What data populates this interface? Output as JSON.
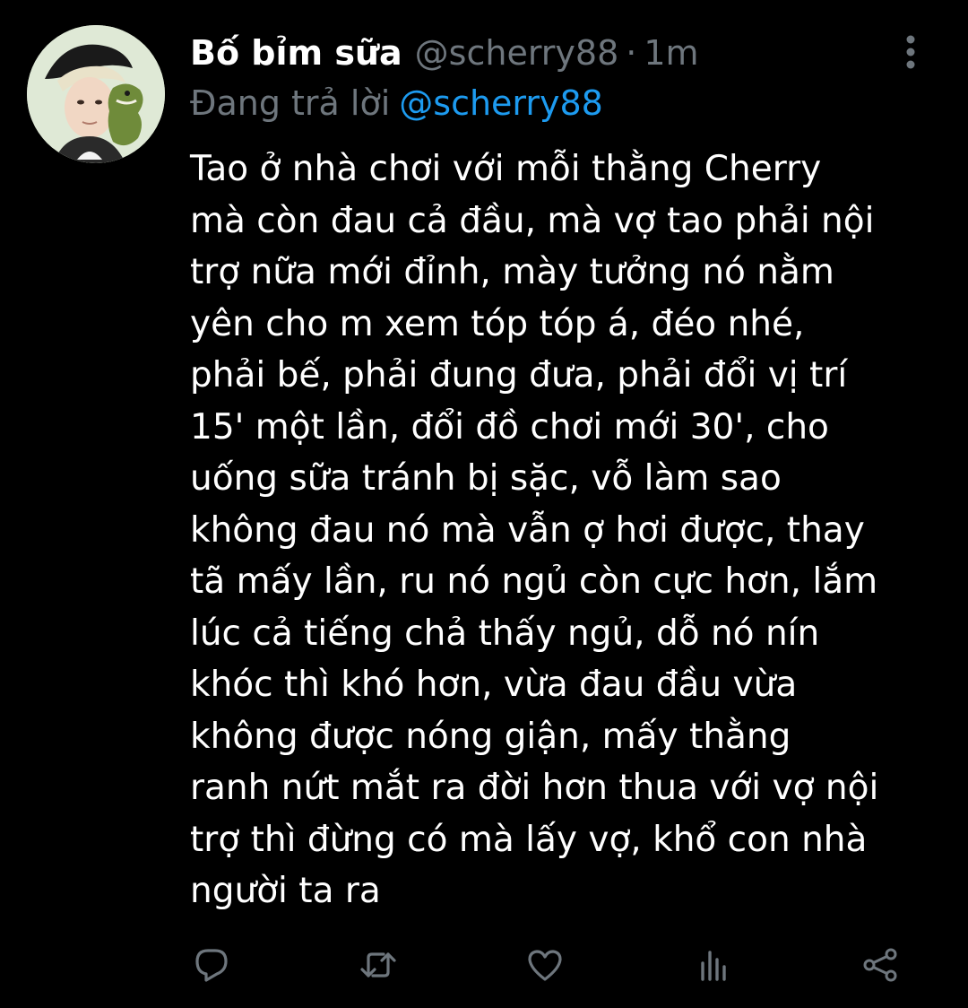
{
  "tweet": {
    "author_name": "Bố bỉm sữa",
    "author_handle": "@scherry88",
    "separator": "·",
    "timestamp": "1m",
    "replying_label": "Đang trả lời",
    "replying_to": "@scherry88",
    "body_lines": [
      "Tao ở nhà chơi với mỗi thằng Cherry",
      "mà còn đau cả đầu, mà vợ tao phải nội",
      "trợ nữa mới đỉnh, mày tưởng nó nằm",
      "yên cho m xem tóp tóp á, đéo nhé,",
      "phải bế, phải đung đưa, phải đổi vị trí",
      "15' một lần, đổi đồ chơi mới 30', cho",
      "uống sữa tránh bị sặc, vỗ làm sao",
      "không đau nó mà vẫn ợ hơi được, thay",
      "tã mấy lần, ru nó ngủ còn cực hơn, lắm",
      "lúc cả tiếng chả thấy ngủ, dỗ nó nín",
      "khóc thì khó hơn, vừa đau đầu vừa",
      "không được nóng giận, mấy thằng",
      "ranh nứt mắt ra đời hơn thua với vợ nội",
      "trợ thì đừng có mà lấy vợ, khổ con nhà",
      "người ta ra"
    ]
  },
  "icons": {
    "more": "more-vertical-icon",
    "reply": "reply-icon",
    "retweet": "retweet-icon",
    "like": "heart-icon",
    "analytics": "analytics-icon",
    "share": "share-icon"
  },
  "colors": {
    "background": "#000000",
    "text": "#ffffff",
    "muted": "#6e767d",
    "link": "#1d9bf0"
  }
}
